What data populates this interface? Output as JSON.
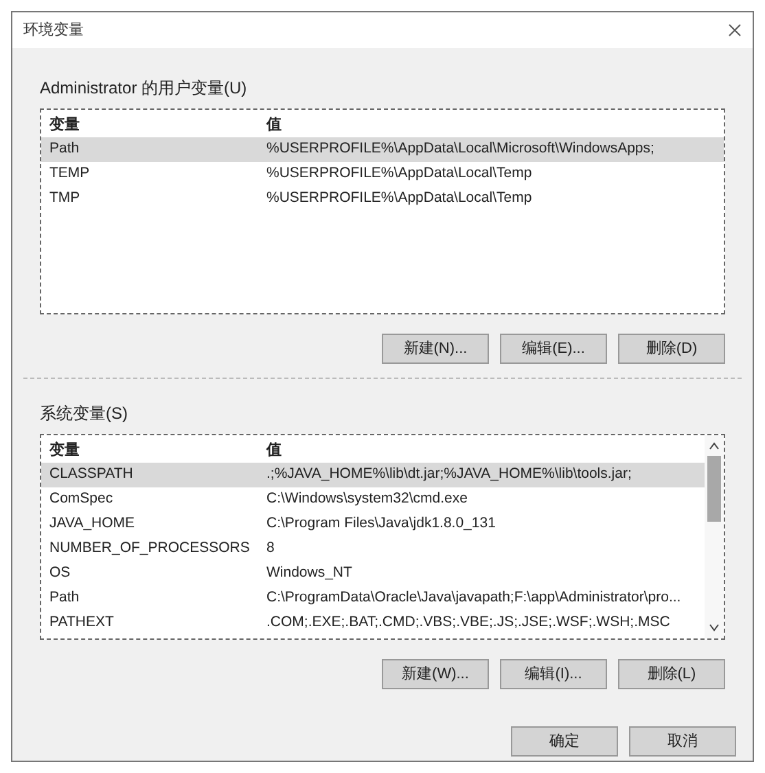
{
  "window": {
    "title": "环境变量"
  },
  "user_variables": {
    "label": "Administrator 的用户变量(U)",
    "columns": [
      "变量",
      "值"
    ],
    "rows": [
      {
        "name": "Path",
        "value": "%USERPROFILE%\\AppData\\Local\\Microsoft\\WindowsApps;",
        "selected": true
      },
      {
        "name": "TEMP",
        "value": "%USERPROFILE%\\AppData\\Local\\Temp",
        "selected": false
      },
      {
        "name": "TMP",
        "value": "%USERPROFILE%\\AppData\\Local\\Temp",
        "selected": false
      }
    ],
    "buttons": [
      "新建(N)...",
      "编辑(E)...",
      "删除(D)"
    ]
  },
  "system_variables": {
    "label": "系统变量(S)",
    "columns": [
      "变量",
      "值"
    ],
    "rows": [
      {
        "name": "CLASSPATH",
        "value": ".;%JAVA_HOME%\\lib\\dt.jar;%JAVA_HOME%\\lib\\tools.jar;",
        "selected": true
      },
      {
        "name": "ComSpec",
        "value": "C:\\Windows\\system32\\cmd.exe",
        "selected": false
      },
      {
        "name": "JAVA_HOME",
        "value": "C:\\Program Files\\Java\\jdk1.8.0_131",
        "selected": false
      },
      {
        "name": "NUMBER_OF_PROCESSORS",
        "value": "8",
        "selected": false
      },
      {
        "name": "OS",
        "value": "Windows_NT",
        "selected": false
      },
      {
        "name": "Path",
        "value": "C:\\ProgramData\\Oracle\\Java\\javapath;F:\\app\\Administrator\\pro...",
        "selected": false
      },
      {
        "name": "PATHEXT",
        "value": ".COM;.EXE;.BAT;.CMD;.VBS;.VBE;.JS;.JSE;.WSF;.WSH;.MSC",
        "selected": false
      }
    ],
    "buttons": [
      "新建(W)...",
      "编辑(I)...",
      "删除(L)"
    ]
  },
  "dialog_buttons": [
    "确定",
    "取消"
  ]
}
